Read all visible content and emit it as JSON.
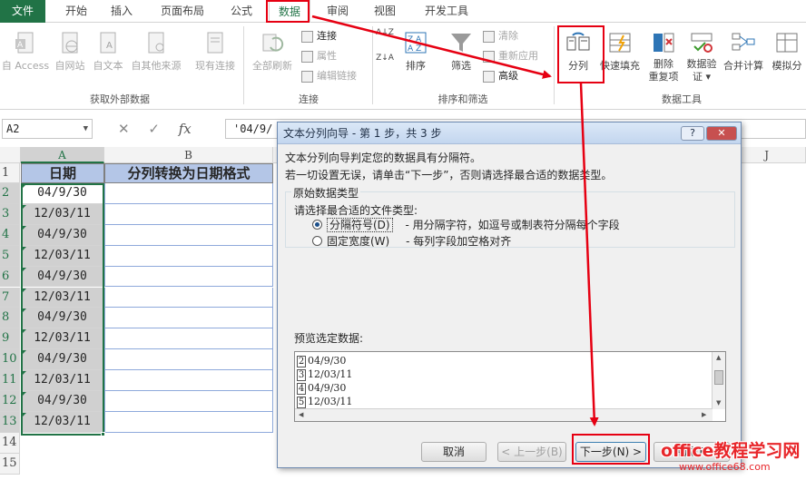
{
  "tabs": [
    {
      "label": "文件"
    },
    {
      "label": "开始"
    },
    {
      "label": "插入"
    },
    {
      "label": "页面布局"
    },
    {
      "label": "公式"
    },
    {
      "label": "数据"
    },
    {
      "label": "审阅"
    },
    {
      "label": "视图"
    },
    {
      "label": "开发工具"
    }
  ],
  "ribbon": {
    "external": {
      "access": "自 Access",
      "web": "自网站",
      "text": "自文本",
      "other": "自其他来源",
      "group": "获取外部数据"
    },
    "existing": "现有连接",
    "refresh": "全部刷新",
    "conn": {
      "connections": "连接",
      "properties": "属性",
      "edit_links": "编辑链接",
      "group": "连接"
    },
    "sort": {
      "az": "A↓Z",
      "za": "Z↓A",
      "sort": "排序",
      "filter": "筛选",
      "clear": "清除",
      "reapply": "重新应用",
      "advanced": "高级",
      "group": "排序和筛选"
    },
    "tools": {
      "split": "分列",
      "flash_fill": "快速填充",
      "remove_dup_1": "删除",
      "remove_dup_2": "重复项",
      "validation_1": "数据验",
      "validation_2": "证 ▾",
      "consolidate": "合并计算",
      "whatif": "模拟分",
      "group": "数据工具"
    }
  },
  "formula_bar": {
    "name_box": "A2",
    "fx": "fx",
    "value": "'04/9/"
  },
  "sheet": {
    "columns": [
      "A",
      "B",
      "J"
    ],
    "header_row": {
      "a": "日期",
      "b": "分列转换为日期格式"
    },
    "row_numbers": [
      "1",
      "2",
      "3",
      "4",
      "5",
      "6",
      "7",
      "8",
      "9",
      "10",
      "11",
      "12",
      "13",
      "14",
      "15"
    ],
    "dates": [
      "04/9/30",
      "12/03/11",
      "04/9/30",
      "12/03/11",
      "04/9/30",
      "12/03/11",
      "04/9/30",
      "12/03/11",
      "04/9/30",
      "12/03/11",
      "04/9/30",
      "12/03/11"
    ]
  },
  "dialog": {
    "title": "文本分列向导 - 第 1 步，共 3 步",
    "help": "?",
    "close": "✕",
    "line1": "文本分列向导判定您的数据具有分隔符。",
    "line2": "若一切设置无误，请单击“下一步”，否则请选择最合适的数据类型。",
    "group_title": "原始数据类型",
    "choose": "请选择最合适的文件类型:",
    "opt_delimited": "分隔符号(D)",
    "opt_delimited_desc": "- 用分隔字符，如逗号或制表符分隔每个字段",
    "opt_fixed": "固定宽度(W)",
    "opt_fixed_desc": "- 每列字段加空格对齐",
    "preview_label": "预览选定数据:",
    "preview_rows": [
      {
        "num": "2",
        "text": "04/9/30"
      },
      {
        "num": "3",
        "text": "12/03/11"
      },
      {
        "num": "4",
        "text": "04/9/30"
      },
      {
        "num": "5",
        "text": "12/03/11"
      }
    ],
    "btn_cancel": "取消",
    "btn_back": "< 上一步(B)",
    "btn_next": "下一步(N) >",
    "btn_finish": "完成(F)"
  },
  "watermark": {
    "line1": "office教程学习网",
    "line2": "www.office68.com"
  },
  "colors": {
    "excel_green": "#217346",
    "header_fill": "#b4c6e7",
    "red_highlight": "#e60012"
  }
}
